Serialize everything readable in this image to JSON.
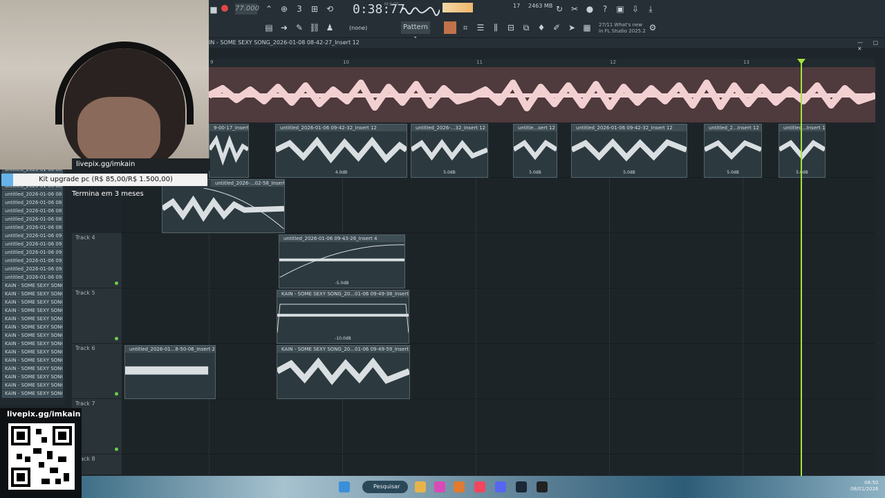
{
  "toolbar": {
    "tempo": "77.000",
    "time": "0:38:77",
    "time_sub": "M:S:CS",
    "cpu": "17",
    "memory": "2463 MB",
    "pattern_none": "(none)",
    "pattern_label": "Pattern 1",
    "news_date": "27/11",
    "news_title": "What's new",
    "news_sub": "in FL Studio 2025.2"
  },
  "playlist": {
    "title": "IN - SOME SEXY SONG_2026-01-08 08-42-27_Insert 12",
    "window_controls": "— ▢ ✕",
    "ruler": [
      "9",
      "10",
      "11",
      "12",
      "13"
    ]
  },
  "tracks": [
    {
      "label": "Track 4"
    },
    {
      "label": "Track 5"
    },
    {
      "label": "Track 6"
    },
    {
      "label": "Track 7"
    },
    {
      "label": "Track 8"
    }
  ],
  "clips": {
    "lane2": [
      {
        "name": "9-00-17_Insert 2",
        "db": ""
      },
      {
        "name": "untitled_2026-01-06 09-42-32_Insert 12",
        "db": "4.0dB"
      },
      {
        "name": "untitled_2026-...32_Insert 12",
        "db": "5.0dB"
      },
      {
        "name": "untitle...sert 12",
        "db": "5.0dB"
      },
      {
        "name": "untitled_2026-01-06 09-42-32_Insert 12",
        "db": "5.0dB"
      },
      {
        "name": "untitled_2...Insert 12",
        "db": "5.0dB"
      },
      {
        "name": "untitled...Insert 12",
        "db": "5.0dB"
      }
    ],
    "lane3": {
      "name": "untitled_2026-...02-58_Insert 2"
    },
    "track4": {
      "name": "untitled_2026-01-06 09-43-26_Insert 4",
      "db": "-5.0dB"
    },
    "track5": {
      "name": "KAIN - SOME SEXY SONG_20...01-06 09-49-38_Insert 12",
      "db": "-10.0dB"
    },
    "track6a": {
      "name": "untitled_2026-01...8-50-06_Insert 2"
    },
    "track6b": {
      "name": "KAIN - SOME SEXY SONG_20...01-06 09-49-59_Insert 12"
    }
  },
  "browser": {
    "items": [
      "untitled_2026-01-06 08-",
      "untitled_2026-01-06 08-",
      "untitled_2026-01-06 08-",
      "untitled_2026-01-06 08-",
      "untitled_2026-01-06 08-",
      "untitled_2026-01-06 08-",
      "untitled_2026-01-06 08-",
      "untitled_2026-01-06 08-",
      "untitled_2026-01-06 08-",
      "untitled_2026-01-06 09-",
      "untitled_2026-01-06 09-",
      "untitled_2026-01-06 09-",
      "untitled_2026-01-06 09-",
      "untitled_2026-01-06 09-",
      "untitled_2026-01-06 09-",
      "KAIN - SOME SEXY SONG_",
      "KAIN - SOME SEXY SONG_",
      "KAIN - SOME SEXY SONG_",
      "KAIN - SOME SEXY SONG_",
      "KAIN - SOME SEXY SONG_",
      "KAIN - SOME SEXY SONG_",
      "KAIN - SOME SEXY SONG_",
      "KAIN - SOME SEXY SONG_",
      "KAIN - SOME SEXY SONG_",
      "KAIN - SOME SEXY SONG_",
      "KAIN - SOME SEXY SONG_",
      "KAIN - SOME SEXY SONG_",
      "KAIN - SOME SEXY SONG_",
      "KAIN - SOME SEXY SONG_"
    ]
  },
  "overlay": {
    "link": "livepix.gg/imkain",
    "goal": "Kit upgrade pc (R$ 85,00/R$ 1.500,00)",
    "goal_progress": 0.057,
    "goal_end": "Termina em 3 meses",
    "qr_title": "livepix.gg/imkain"
  },
  "taskbar": {
    "search": "Pesquisar",
    "time": "08:50",
    "date": "08/01/2026"
  },
  "colors": {
    "playhead": "#a6e13d",
    "audio_lane": "#4f3a3d",
    "clip_bg": "#2c3a40",
    "record": "#e04848"
  }
}
